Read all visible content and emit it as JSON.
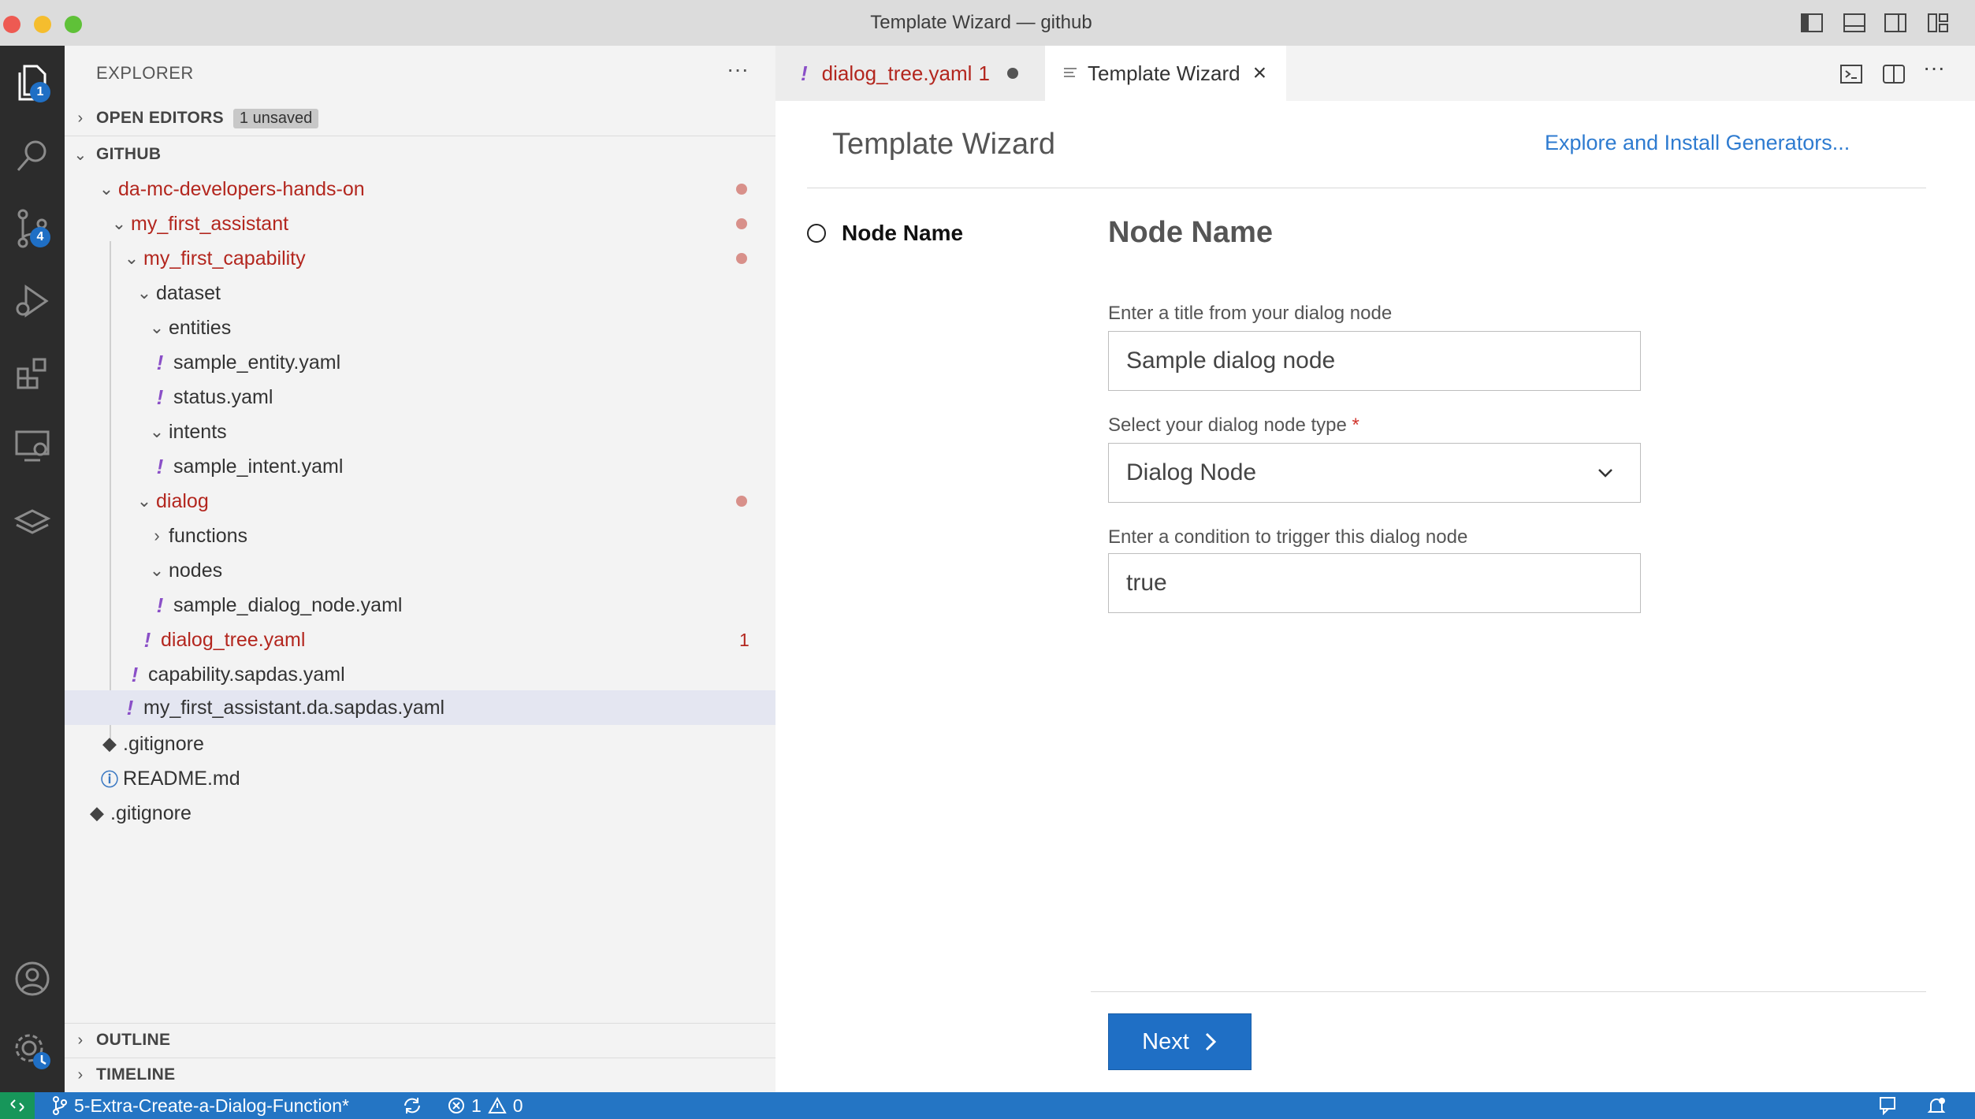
{
  "window": {
    "title": "Template Wizard — github",
    "traffic_colors": {
      "close": "#ee5a52",
      "minimize": "#f5bd2e",
      "zoom": "#5fc138"
    }
  },
  "activity_bar": [
    {
      "icon": "files-icon",
      "badge": "1"
    },
    {
      "icon": "search-icon"
    },
    {
      "icon": "source-control-icon",
      "badge": "4"
    },
    {
      "icon": "run-debug-icon"
    },
    {
      "icon": "extensions-icon"
    },
    {
      "icon": "remote-explorer-icon"
    },
    {
      "icon": "stack-icon"
    }
  ],
  "sidebar": {
    "title": "EXPLORER",
    "open_editors": {
      "label": "OPEN EDITORS",
      "badge": "1 unsaved"
    },
    "workspace": {
      "label": "GITHUB"
    },
    "tree": [
      {
        "name": "da-mc-developers-hands-on",
        "type": "folder",
        "modified": true
      },
      {
        "name": "my_first_assistant",
        "type": "folder",
        "modified": true
      },
      {
        "name": "my_first_capability",
        "type": "folder",
        "modified": true
      },
      {
        "name": "dataset",
        "type": "folder"
      },
      {
        "name": "entities",
        "type": "folder"
      },
      {
        "name": "sample_entity.yaml",
        "type": "yaml"
      },
      {
        "name": "status.yaml",
        "type": "yaml"
      },
      {
        "name": "intents",
        "type": "folder"
      },
      {
        "name": "sample_intent.yaml",
        "type": "yaml"
      },
      {
        "name": "dialog",
        "type": "folder",
        "modified": true
      },
      {
        "name": "functions",
        "type": "folder",
        "collapsed": true
      },
      {
        "name": "nodes",
        "type": "folder"
      },
      {
        "name": "sample_dialog_node.yaml",
        "type": "yaml"
      },
      {
        "name": "dialog_tree.yaml",
        "type": "yaml",
        "problems": "1"
      },
      {
        "name": "capability.sapdas.yaml",
        "type": "yaml"
      },
      {
        "name": "my_first_assistant.da.sapdas.yaml",
        "type": "yaml",
        "selected": true
      },
      {
        "name": ".gitignore",
        "type": "git"
      },
      {
        "name": "README.md",
        "type": "info"
      },
      {
        "name": ".gitignore",
        "type": "git"
      }
    ],
    "outline_label": "OUTLINE",
    "timeline_label": "TIMELINE"
  },
  "tabs": [
    {
      "label": "dialog_tree.yaml",
      "count": "1",
      "dirty": true,
      "active": false
    },
    {
      "label": "Template Wizard",
      "active": true
    }
  ],
  "wizard": {
    "title": "Template Wizard",
    "explore_link": "Explore and Install Generators...",
    "step_label": "Node Name",
    "form_heading": "Node Name",
    "fields": [
      {
        "label": "Enter a title from your dialog node",
        "value": "Sample dialog node"
      },
      {
        "label": "Select your dialog node type",
        "required_mark": "*",
        "value": "Dialog Node"
      },
      {
        "label": "Enter a condition to trigger this dialog node",
        "value": "true"
      }
    ],
    "next_label": "Next"
  },
  "statusbar": {
    "branch": "5-Extra-Create-a-Dialog-Function*",
    "errors": "1",
    "warnings": "0"
  }
}
